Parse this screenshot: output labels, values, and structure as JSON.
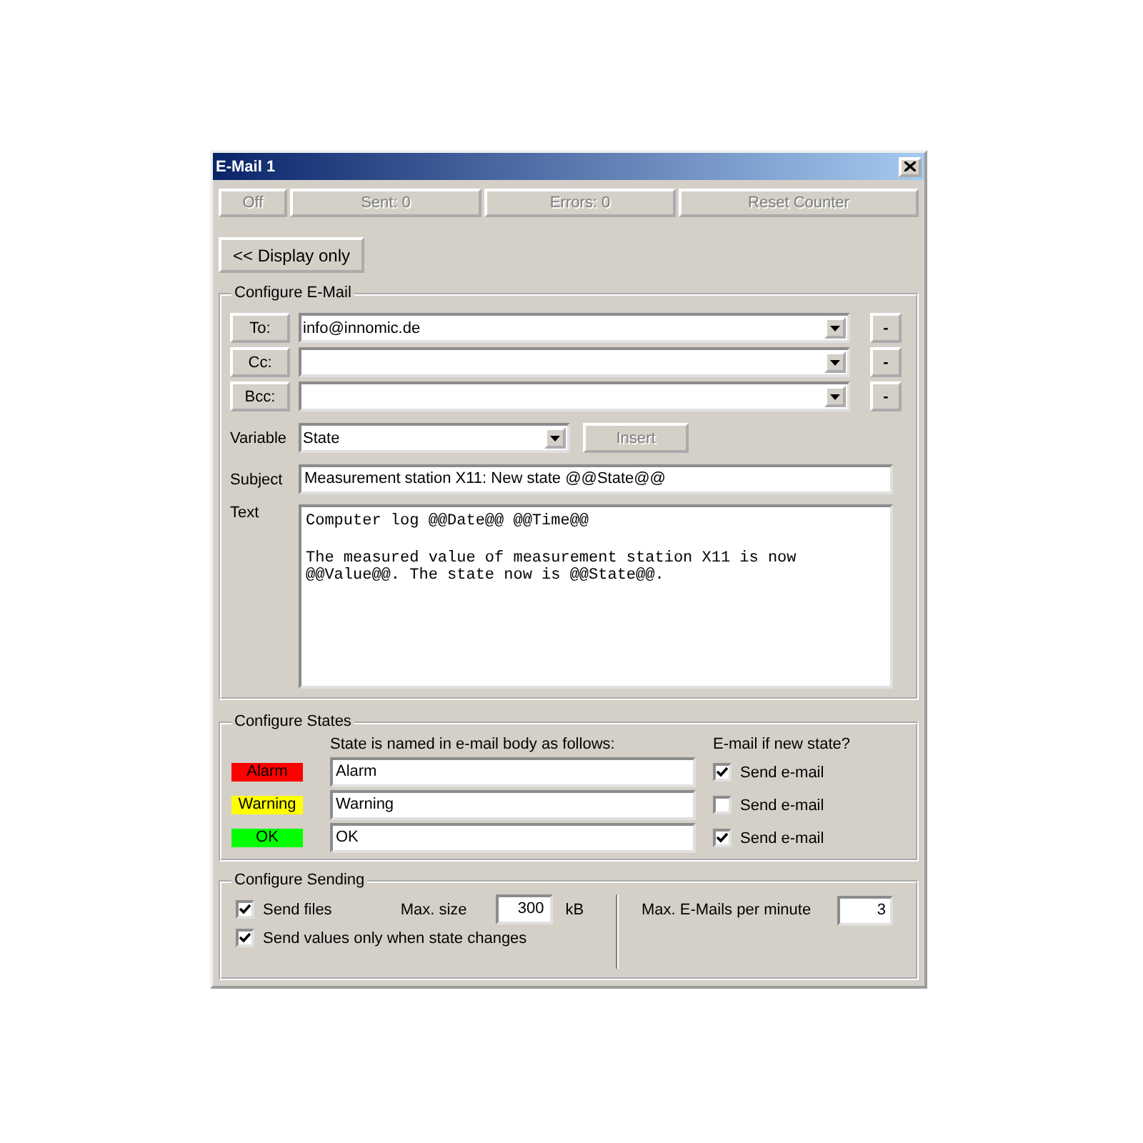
{
  "window": {
    "title": "E-Mail 1"
  },
  "status_bar": [
    {
      "text": "Off",
      "disabled": true
    },
    {
      "text": "Sent: 0",
      "disabled": true
    },
    {
      "text": "Errors: 0",
      "disabled": true
    },
    {
      "text": "Reset Counter",
      "disabled": true
    }
  ],
  "display_button": "<< Display only",
  "configure_email": {
    "title": "Configure E-Mail",
    "recipients": [
      {
        "label": "To:",
        "value": "info@innomic.de",
        "remove": "-"
      },
      {
        "label": "Cc:",
        "remove": "-"
      },
      {
        "label": "Bcc:",
        "remove": "-"
      }
    ],
    "variable": {
      "label": "Variable",
      "value": "State",
      "insert": {
        "text": "Insert",
        "disabled": true
      }
    },
    "subject": {
      "label": "Subject",
      "value": "Measurement station X11: New state @@State@@"
    },
    "text": {
      "label": "Text",
      "paragraphs": [
        [
          "Computer log @@Date@@ @@Time@@"
        ],
        [
          "The measured value of measurement station X11 is now",
          "@@Value@@. The state now is @@State@@."
        ]
      ]
    }
  },
  "configure_states": {
    "title": "Configure States",
    "name_heading": "State is named in e-mail body as follows:",
    "email_heading": "E-mail if new state?",
    "states": [
      {
        "label": "Alarm",
        "color": "#ff0000",
        "name": "Alarm",
        "send_label": "Send e-mail",
        "checked": true
      },
      {
        "label": "Warning",
        "color": "#ffff00",
        "name": "Warning",
        "send_label": "Send e-mail",
        "checked": false
      },
      {
        "label": "OK",
        "color": "#00ff00",
        "name": "OK",
        "send_label": "Send e-mail",
        "checked": true
      }
    ]
  },
  "configure_sending": {
    "title": "Configure Sending",
    "send_files": {
      "label": "Send files",
      "checked": true
    },
    "max_size": {
      "label": "Max. size",
      "value": "300",
      "unit": "kB"
    },
    "send_values_only": {
      "label": "Send values only when state changes",
      "checked": true
    },
    "max_emails": {
      "label": "Max. E-Mails per minute",
      "value": "3"
    }
  }
}
